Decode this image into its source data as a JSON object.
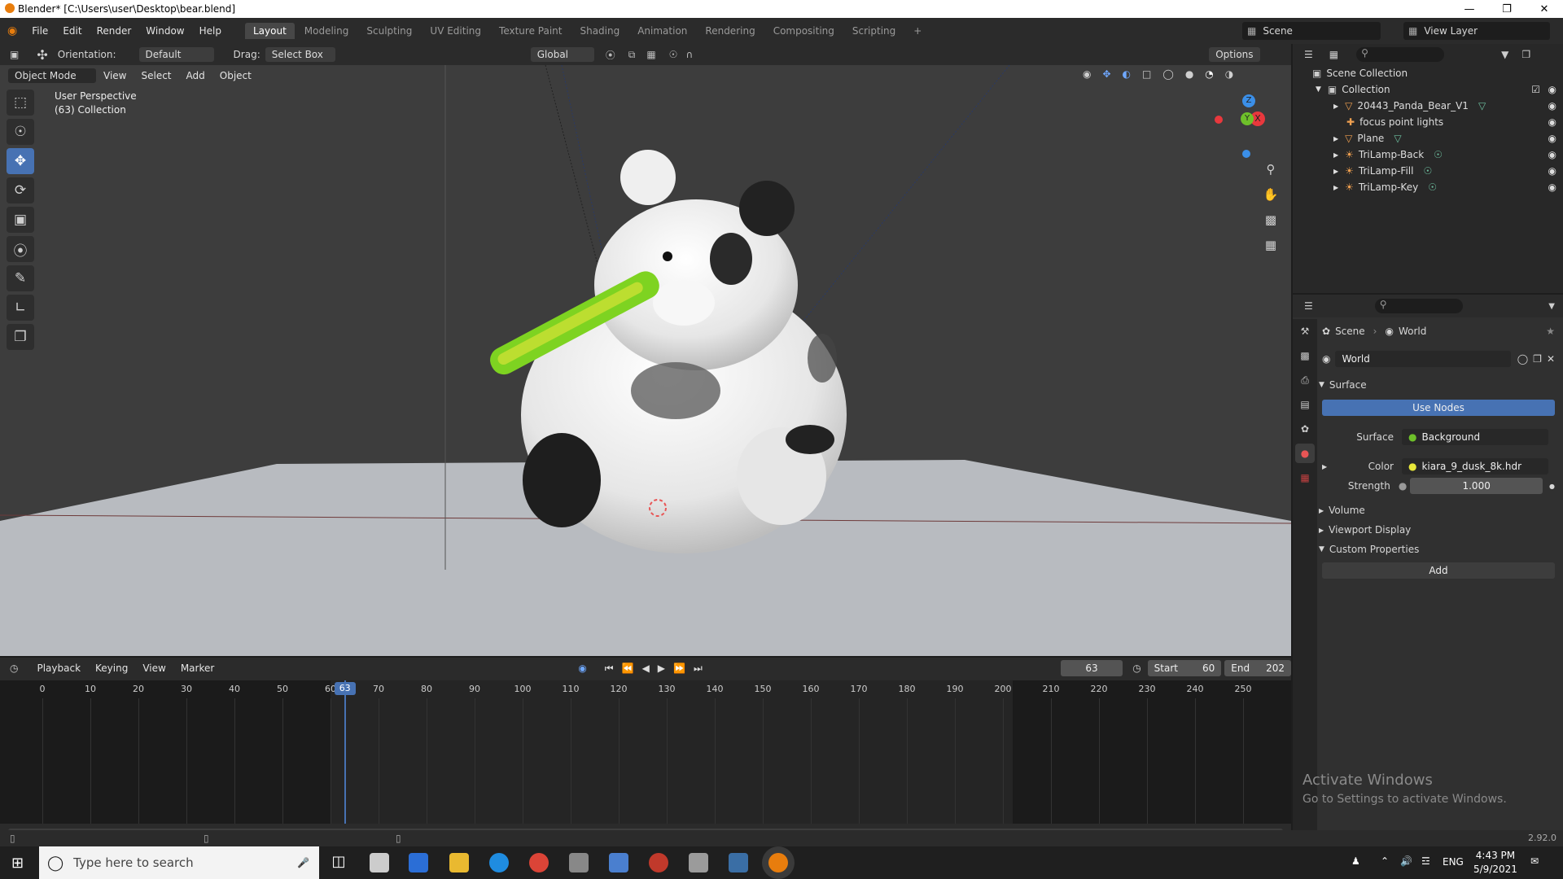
{
  "window": {
    "title": "Blender* [C:\\Users\\user\\Desktop\\bear.blend]"
  },
  "menu": {
    "items": [
      "File",
      "Edit",
      "Render",
      "Window",
      "Help"
    ]
  },
  "workspaces": [
    "Layout",
    "Modeling",
    "Sculpting",
    "UV Editing",
    "Texture Paint",
    "Shading",
    "Animation",
    "Rendering",
    "Compositing",
    "Scripting"
  ],
  "active_workspace": "Layout",
  "scene": {
    "name": "Scene",
    "view_layer": "View Layer"
  },
  "header": {
    "orientation_label": "Orientation:",
    "orientation": "Default",
    "drag_label": "Drag:",
    "drag": "Select Box",
    "transform_space": "Global",
    "options": "Options"
  },
  "viewport": {
    "mode": "Object Mode",
    "menus": [
      "View",
      "Select",
      "Add",
      "Object"
    ],
    "perspective": "User Perspective",
    "collection": "(63) Collection",
    "gizmo_axes": {
      "x": "X",
      "y": "Y",
      "z": "Z"
    }
  },
  "outliner": {
    "root": "Scene Collection",
    "collection": "Collection",
    "objects": [
      "20443_Panda_Bear_V1",
      "focus point lights",
      "Plane",
      "TriLamp-Back",
      "TriLamp-Fill",
      "TriLamp-Key"
    ]
  },
  "properties": {
    "breadcrumb": [
      "Scene",
      "World"
    ],
    "world_name": "World",
    "panel_surface": "Surface",
    "use_nodes": "Use Nodes",
    "surface_label": "Surface",
    "surface_value": "Background",
    "color_label": "Color",
    "color_value": "kiara_9_dusk_8k.hdr",
    "strength_label": "Strength",
    "strength_value": "1.000",
    "panels": [
      "Volume",
      "Viewport Display",
      "Custom Properties"
    ],
    "add_button": "Add"
  },
  "timeline": {
    "menus": [
      "Playback",
      "Keying",
      "View",
      "Marker"
    ],
    "current_frame": "63",
    "start_label": "Start",
    "start": "60",
    "end_label": "End",
    "end": "202",
    "ticks": [
      "0",
      "10",
      "20",
      "30",
      "40",
      "50",
      "60",
      "70",
      "80",
      "90",
      "100",
      "110",
      "120",
      "130",
      "140",
      "150",
      "160",
      "170",
      "180",
      "190",
      "200",
      "210",
      "220",
      "230",
      "240",
      "250"
    ]
  },
  "status": {
    "version": "2.92.0"
  },
  "watermark": {
    "line1": "Activate Windows",
    "line2": "Go to Settings to activate Windows."
  },
  "taskbar": {
    "search_placeholder": "Type here to search",
    "time": "4:43 PM",
    "date": "5/9/2021",
    "lang": "ENG"
  },
  "colors": {
    "accent": "#4772b3",
    "active_tool": "#4772b3",
    "x_axis": "#e8383d",
    "y_axis": "#6ec02a",
    "z_axis": "#3b8fe8"
  }
}
